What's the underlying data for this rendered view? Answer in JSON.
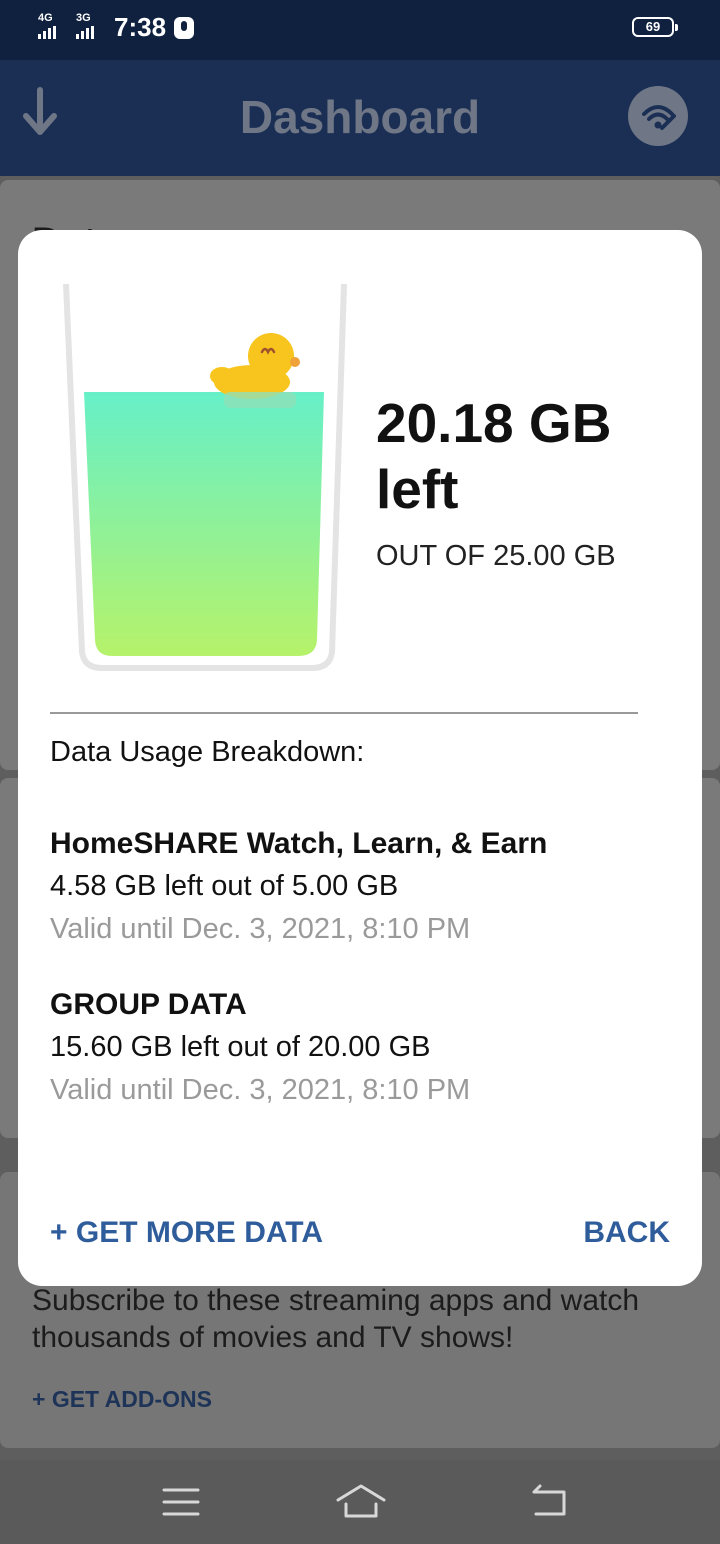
{
  "status_bar": {
    "signal1_label": "4G",
    "signal2_label": "3G",
    "time": "7:38",
    "battery": "69"
  },
  "app_bar": {
    "title": "Dashboard",
    "left_icon": "download-arrow-icon",
    "right_icon": "wifi-icon"
  },
  "background": {
    "section_title": "Dat",
    "streaming_text": "Subscribe to these streaming apps and watch thousands of movies and TV shows!",
    "addons_link": "+ GET ADD-ONS"
  },
  "modal": {
    "remaining_value": "20.18 GB",
    "remaining_suffix": "left",
    "total_text": "OUT OF 25.00 GB",
    "fill_fraction": 0.81,
    "breakdown_heading": "Data Usage Breakdown:",
    "items": [
      {
        "name": "HomeSHARE Watch, Learn, & Earn",
        "amount": "4.58 GB left out of 5.00 GB",
        "validity": "Valid until Dec. 3, 2021, 8:10 PM"
      },
      {
        "name": "GROUP DATA",
        "amount": "15.60 GB left out of 20.00 GB",
        "validity": "Valid until Dec. 3, 2021, 8:10 PM"
      }
    ],
    "get_more_label": "+ GET MORE DATA",
    "back_label": "BACK"
  },
  "nav_bar": {
    "icons": [
      "menu-icon",
      "home-icon",
      "back-icon"
    ]
  },
  "colors": {
    "status_bar": "#10213f",
    "app_bar": "#1b2f55",
    "accent_link": "#2f5c9a",
    "liquid_top": "#66f0c8",
    "liquid_bottom": "#b6f26a"
  }
}
